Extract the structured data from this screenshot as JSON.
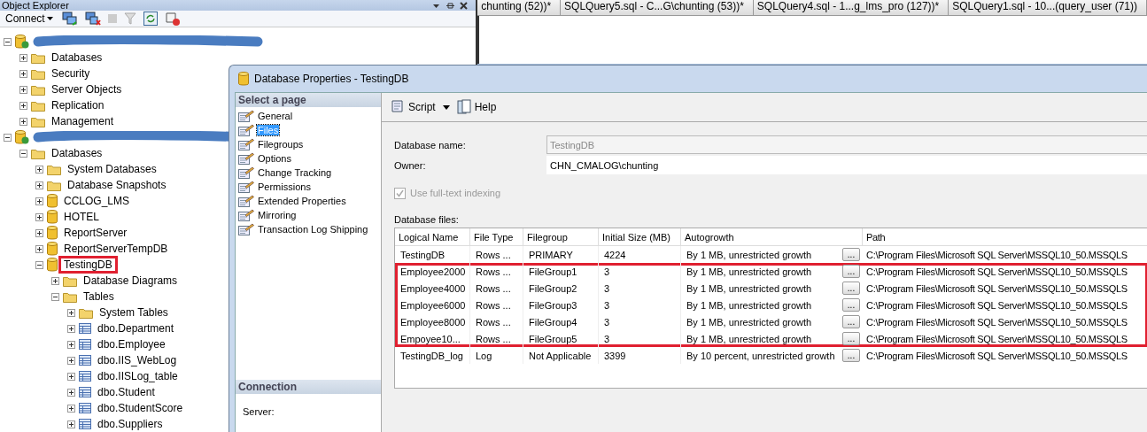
{
  "object_explorer": {
    "title": "Object Explorer",
    "connect": "Connect",
    "tree": [
      {
        "kind": "server",
        "redacted": true,
        "expanded": true,
        "children": [
          {
            "kind": "folder",
            "label": "Databases",
            "expanded": false,
            "highlighted": false
          },
          {
            "kind": "folder",
            "label": "Security",
            "expanded": false,
            "highlighted": false
          },
          {
            "kind": "folder",
            "label": "Server Objects",
            "expanded": false,
            "highlighted": false
          },
          {
            "kind": "folder",
            "label": "Replication",
            "expanded": false,
            "highlighted": false
          },
          {
            "kind": "folder",
            "label": "Management",
            "expanded": false,
            "highlighted": false
          }
        ]
      },
      {
        "kind": "server",
        "redacted": true,
        "expanded": true,
        "children": [
          {
            "kind": "folder",
            "label": "Databases",
            "expanded": true,
            "highlighted": false,
            "children": [
              {
                "kind": "folder",
                "label": "System Databases",
                "expanded": false,
                "highlighted": false
              },
              {
                "kind": "folder",
                "label": "Database Snapshots",
                "expanded": false,
                "highlighted": false
              },
              {
                "kind": "database",
                "label": "CCLOG_LMS",
                "expanded": false,
                "highlighted": false
              },
              {
                "kind": "database",
                "label": "HOTEL",
                "expanded": false,
                "highlighted": false
              },
              {
                "kind": "database",
                "label": "ReportServer",
                "expanded": false,
                "highlighted": false
              },
              {
                "kind": "database",
                "label": "ReportServerTempDB",
                "expanded": false,
                "highlighted": false
              },
              {
                "kind": "database",
                "label": "TestingDB",
                "expanded": true,
                "highlighted": true,
                "children": [
                  {
                    "kind": "folder",
                    "label": "Database Diagrams",
                    "expanded": false,
                    "highlighted": false
                  },
                  {
                    "kind": "folder",
                    "label": "Tables",
                    "expanded": true,
                    "highlighted": false,
                    "children": [
                      {
                        "kind": "folder",
                        "label": "System Tables",
                        "expanded": false,
                        "highlighted": false
                      },
                      {
                        "kind": "table",
                        "label": "dbo.Department",
                        "expanded": false,
                        "highlighted": false
                      },
                      {
                        "kind": "table",
                        "label": "dbo.Employee",
                        "expanded": false,
                        "highlighted": false
                      },
                      {
                        "kind": "table",
                        "label": "dbo.IIS_WebLog",
                        "expanded": false,
                        "highlighted": false
                      },
                      {
                        "kind": "table",
                        "label": "dbo.IISLog_table",
                        "expanded": false,
                        "highlighted": false
                      },
                      {
                        "kind": "table",
                        "label": "dbo.Student",
                        "expanded": false,
                        "highlighted": false
                      },
                      {
                        "kind": "table",
                        "label": "dbo.StudentScore",
                        "expanded": false,
                        "highlighted": false
                      },
                      {
                        "kind": "table",
                        "label": "dbo.Suppliers",
                        "expanded": false,
                        "highlighted": false
                      }
                    ]
                  }
                ]
              }
            ]
          }
        ]
      }
    ]
  },
  "editor": {
    "tabs": [
      {
        "label": "chunting (52))*",
        "selected": false
      },
      {
        "label": "SQLQuery5.sql - C...G\\chunting (53))*",
        "selected": false
      },
      {
        "label": "SQLQuery4.sql - 1...g_lms_pro (127))*",
        "selected": false
      },
      {
        "label": "SQLQuery1.sql - 10...(query_user (71))",
        "selected": false
      }
    ]
  },
  "dialog": {
    "title": "Database Properties - TestingDB",
    "select_page": {
      "title": "Select a page",
      "items": [
        {
          "label": "General",
          "selected": false
        },
        {
          "label": "Files",
          "selected": true
        },
        {
          "label": "Filegroups",
          "selected": false
        },
        {
          "label": "Options",
          "selected": false
        },
        {
          "label": "Change Tracking",
          "selected": false
        },
        {
          "label": "Permissions",
          "selected": false
        },
        {
          "label": "Extended Properties",
          "selected": false
        },
        {
          "label": "Mirroring",
          "selected": false
        },
        {
          "label": "Transaction Log Shipping",
          "selected": false
        }
      ]
    },
    "connection": {
      "title": "Connection",
      "server_label": "Server:"
    },
    "toolbar": {
      "script": "Script",
      "help": "Help"
    },
    "database_name": {
      "label": "Database name:",
      "value": "TestingDB",
      "disabled": true
    },
    "owner": {
      "label": "Owner:",
      "value": "CHN_CMALOG\\chunting",
      "disabled": false
    },
    "fulltext": {
      "label": "Use full-text indexing",
      "checked": true,
      "disabled": true
    },
    "files": {
      "title": "Database files:",
      "columns": [
        "Logical Name",
        "File Type",
        "Filegroup",
        "Initial Size (MB)",
        "Autogrowth",
        "Path"
      ],
      "rows": [
        {
          "logical_name": "TestingDB",
          "file_type": "Rows ...",
          "filegroup": "PRIMARY",
          "initial_size": "4224",
          "autogrowth": "By 1 MB, unrestricted growth",
          "browse": "...",
          "path": "C:\\Program Files\\Microsoft SQL Server\\MSSQL10_50.MSSQLS",
          "highlighted": false
        },
        {
          "logical_name": "Employee2000",
          "file_type": "Rows ...",
          "filegroup": "FileGroup1",
          "initial_size": "3",
          "autogrowth": "By 1 MB, unrestricted growth",
          "browse": "...",
          "path": "C:\\Program Files\\Microsoft SQL Server\\MSSQL10_50.MSSQLS",
          "highlighted": true
        },
        {
          "logical_name": "Employee4000",
          "file_type": "Rows ...",
          "filegroup": "FileGroup2",
          "initial_size": "3",
          "autogrowth": "By 1 MB, unrestricted growth",
          "browse": "...",
          "path": "C:\\Program Files\\Microsoft SQL Server\\MSSQL10_50.MSSQLS",
          "highlighted": true
        },
        {
          "logical_name": "Employee6000",
          "file_type": "Rows ...",
          "filegroup": "FileGroup3",
          "initial_size": "3",
          "autogrowth": "By 1 MB, unrestricted growth",
          "browse": "...",
          "path": "C:\\Program Files\\Microsoft SQL Server\\MSSQL10_50.MSSQLS",
          "highlighted": true
        },
        {
          "logical_name": "Employee8000",
          "file_type": "Rows ...",
          "filegroup": "FileGroup4",
          "initial_size": "3",
          "autogrowth": "By 1 MB, unrestricted growth",
          "browse": "...",
          "path": "C:\\Program Files\\Microsoft SQL Server\\MSSQL10_50.MSSQLS",
          "highlighted": true
        },
        {
          "logical_name": "Empoyee10...",
          "file_type": "Rows ...",
          "filegroup": "FileGroup5",
          "initial_size": "3",
          "autogrowth": "By 1 MB, unrestricted growth",
          "browse": "...",
          "path": "C:\\Program Files\\Microsoft SQL Server\\MSSQL10_50.MSSQLS",
          "highlighted": true
        },
        {
          "logical_name": "TestingDB_log",
          "file_type": "Log",
          "filegroup": "Not Applicable",
          "initial_size": "3399",
          "autogrowth": "By 10 percent, unrestricted growth",
          "browse": "...",
          "path": "C:\\Program Files\\Microsoft SQL Server\\MSSQL10_50.MSSQLS",
          "highlighted": false
        }
      ]
    }
  }
}
